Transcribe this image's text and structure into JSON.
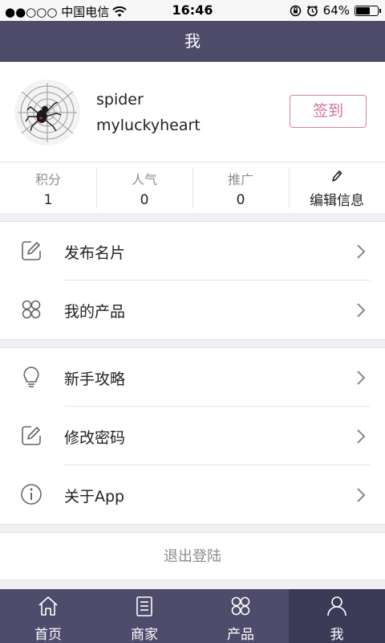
{
  "status_bar": {
    "carrier": "●●○○○ 中国电信",
    "time": "16:46",
    "battery": "64%",
    "battery_level": 0.64
  },
  "nav": {
    "title": "我"
  },
  "profile": {
    "name": "spider",
    "subtitle": "myluckyheart",
    "signin_label": "签到"
  },
  "stats": [
    {
      "label": "积分",
      "value": "1"
    },
    {
      "label": "人气",
      "value": "0"
    },
    {
      "label": "推广",
      "value": "0"
    }
  ],
  "edit_info_label": "编辑信息",
  "menu_group_1": [
    {
      "label": "发布名片",
      "icon": "edit-icon"
    },
    {
      "label": "我的产品",
      "icon": "four-circles-icon"
    }
  ],
  "menu_group_2": [
    {
      "label": "新手攻略",
      "icon": "lightbulb-icon"
    },
    {
      "label": "修改密码",
      "icon": "edit-icon"
    },
    {
      "label": "关于App",
      "icon": "info-icon"
    }
  ],
  "logout_label": "退出登陆",
  "tabs": [
    {
      "label": "首页",
      "icon": "home-icon"
    },
    {
      "label": "商家",
      "icon": "list-icon"
    },
    {
      "label": "产品",
      "icon": "four-circles-icon"
    },
    {
      "label": "我",
      "icon": "person-icon",
      "active": true
    }
  ],
  "colors": {
    "nav_bg": "#4e4b6b",
    "tab_active_bg": "#3d3a57",
    "accent_pink": "#d0729b"
  }
}
